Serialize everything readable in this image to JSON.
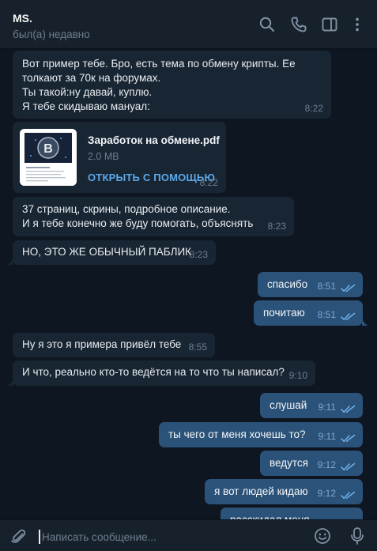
{
  "header": {
    "name": "MS.",
    "status": "был(а) недавно"
  },
  "icons": {
    "search": "search-icon",
    "call": "phone-icon",
    "sidebar": "sidebar-toggle-icon",
    "more": "more-vertical-icon",
    "attach": "paperclip-icon",
    "emoji": "emoji-icon",
    "mic": "microphone-icon",
    "read": "double-check-icon"
  },
  "colors": {
    "background": "#0e1621",
    "incoming_bubble": "#182533",
    "outgoing_bubble": "#2b5278",
    "accent": "#5aa8ea"
  },
  "messages": [
    {
      "dir": "in",
      "text": "Вот пример тебе. Бро, есть тема по обмену крипты. Ее\nтолкают за 70к на форумах.\nТы такой:ну давай, куплю.\nЯ тебе скидываю мануал:",
      "time": "8:22"
    },
    {
      "dir": "in",
      "type": "file",
      "file_name": "Заработок на обмене.pdf",
      "file_size": "2.0 MB",
      "action": "ОТКРЫТЬ С ПОМОЩЬЮ",
      "time": "8:22"
    },
    {
      "dir": "in",
      "text": "37 страниц, скрины, подробное описание.\nИ я тебе конечно же буду помогать, объяснять",
      "time": "8:23"
    },
    {
      "dir": "in",
      "text": "НО, ЭТО ЖЕ ОБЫЧНЫЙ ПАБЛИК",
      "time": "8:23"
    },
    {
      "dir": "out",
      "text": "спасибо",
      "time": "8:51"
    },
    {
      "dir": "out",
      "text": "почитаю",
      "time": "8:51"
    },
    {
      "dir": "in",
      "text": "Ну я это я примера привёл тебе",
      "time": "8:55"
    },
    {
      "dir": "in",
      "text": "И что, реально кто-то ведётся на то что ты написал?",
      "time": "9:10"
    },
    {
      "dir": "out",
      "text": "слушай",
      "time": "9:11"
    },
    {
      "dir": "out",
      "text": "ты чего от меня хочешь то?",
      "time": "9:11"
    },
    {
      "dir": "out",
      "text": "ведутся",
      "time": "9:12"
    },
    {
      "dir": "out",
      "text": "я вот людей кидаю",
      "time": "9:12"
    },
    {
      "dir": "out",
      "text": "расскидал меня",
      "time": ""
    }
  ],
  "composer": {
    "placeholder": "Написать сообщение..."
  }
}
